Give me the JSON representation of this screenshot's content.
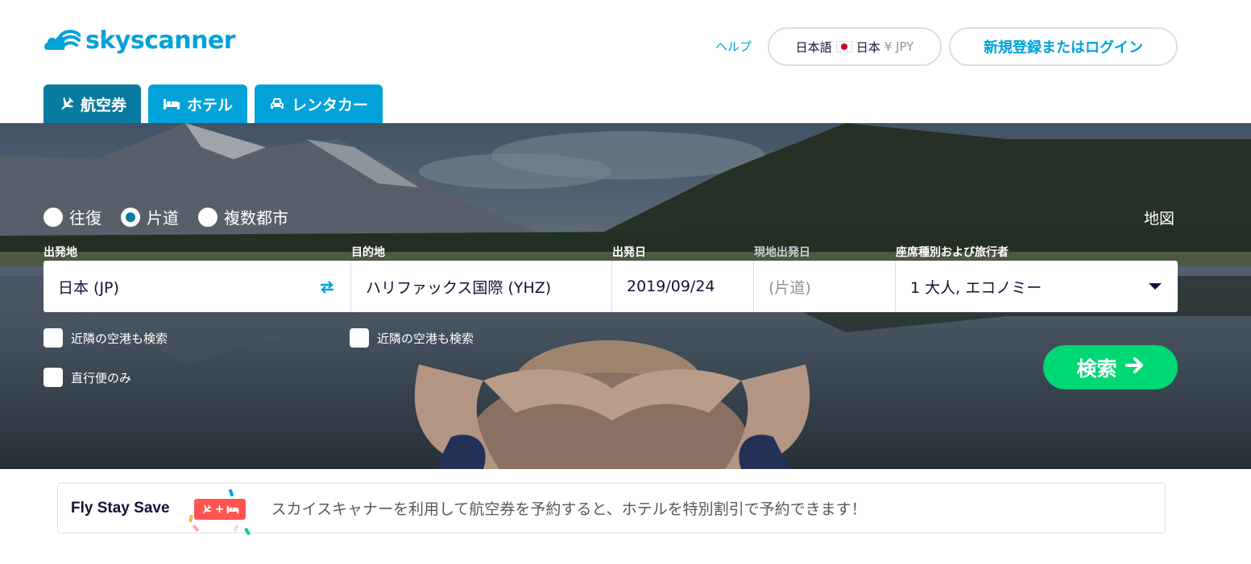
{
  "header": {
    "logo_text": "skyscanner",
    "help_label": "ヘルプ",
    "locale": {
      "language": "日本語",
      "country": "日本",
      "currency": "¥ JPY"
    },
    "login_label": "新規登録またはログイン"
  },
  "tabs": [
    {
      "label": "航空券",
      "icon": "airplane-icon",
      "active": true
    },
    {
      "label": "ホテル",
      "icon": "bed-icon",
      "active": false
    },
    {
      "label": "レンタカー",
      "icon": "car-icon",
      "active": false
    }
  ],
  "search": {
    "trip_types": [
      {
        "label": "往復",
        "checked": false
      },
      {
        "label": "片道",
        "checked": true
      },
      {
        "label": "複数都市",
        "checked": false
      }
    ],
    "map_label": "地図",
    "labels": {
      "origin": "出発地",
      "destination": "目的地",
      "depart": "出発日",
      "return": "現地出発日",
      "cabin": "座席種別および旅行者"
    },
    "values": {
      "origin": "日本 (JP)",
      "destination": "ハリファックス国際 (YHZ)",
      "depart": "2019/09/24",
      "return": "(片道)",
      "cabin": "1 大人, エコノミー"
    },
    "nearby_origin": "近隣の空港も検索",
    "nearby_destination": "近隣の空港も検索",
    "direct_only": "直行便のみ",
    "search_button": "検索"
  },
  "promo": {
    "title": "Fly Stay Save",
    "badge_plus": "+",
    "text": "スカイスキャナーを利用して航空券を予約すると、ホテルを特別割引で予約できます！"
  },
  "colors": {
    "brand": "#00a2d9",
    "active_tab": "#0a7ba0",
    "search_button": "#00d775",
    "promo_badge": "#ff5452"
  }
}
